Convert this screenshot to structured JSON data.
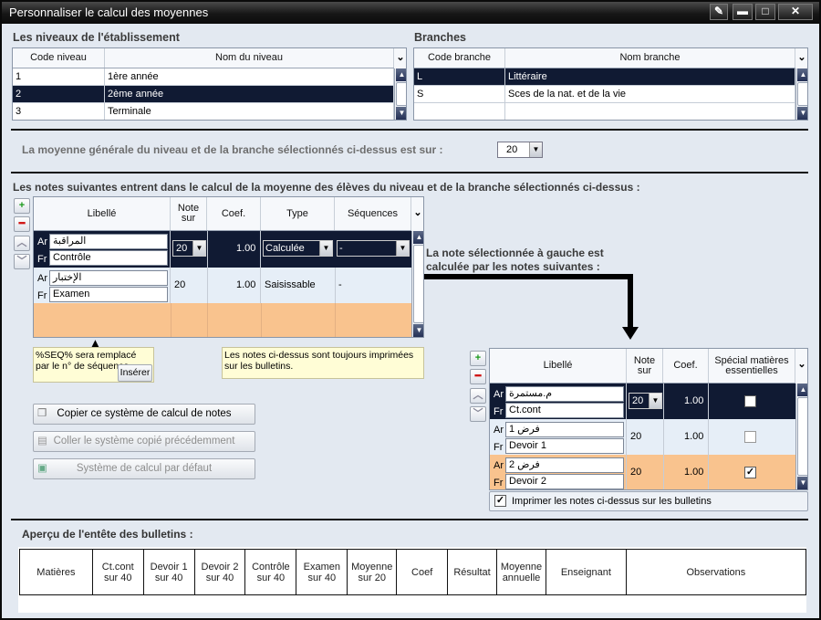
{
  "window": {
    "title": "Personnaliser le calcul des moyennes"
  },
  "niveaux": {
    "title": "Les niveaux de l'établissement",
    "col_code": "Code niveau",
    "col_nom": "Nom du niveau",
    "rows": [
      {
        "code": "1",
        "nom": "1ère année"
      },
      {
        "code": "2",
        "nom": "2ème année"
      },
      {
        "code": "3",
        "nom": "Terminale"
      }
    ],
    "selected_index": 1
  },
  "branches": {
    "title": "Branches",
    "col_code": "Code branche",
    "col_nom": "Nom branche",
    "rows": [
      {
        "code": "L",
        "nom": "Littéraire"
      },
      {
        "code": "S",
        "nom": "Sces de la nat. et de la vie"
      }
    ],
    "selected_index": 0
  },
  "moyenne": {
    "label": "La moyenne générale du niveau et de la branche sélectionnés ci-dessus est sur :",
    "value": "20"
  },
  "notes": {
    "title": "Les notes suivantes entrent dans le calcul de la moyenne des élèves du niveau et de la branche sélectionnés ci-dessus :",
    "col_libelle": "Libellé",
    "col_note": "Note sur",
    "col_coef": "Coef.",
    "col_type": "Type",
    "col_seq": "Séquences",
    "rows": [
      {
        "ar_tag": "Ar",
        "ar": "المراقبة",
        "fr_tag": "Fr",
        "fr": "Contrôle",
        "note": "20",
        "coef": "1.00",
        "type": "Calculée",
        "seq": "-"
      },
      {
        "ar_tag": "Ar",
        "ar": "الإختبار",
        "fr_tag": "Fr",
        "fr": "Examen",
        "note": "20",
        "coef": "1.00",
        "type": "Saisissable",
        "seq": "-"
      }
    ]
  },
  "tips": {
    "seq": "%SEQ% sera remplacé par le n° de séquence",
    "inserer": "Insérer",
    "print": "Les notes ci-dessus sont toujours imprimées sur les bulletins."
  },
  "actions": {
    "copy": "Copier ce système de calcul de notes",
    "paste": "Coller le système copié précédemment",
    "default": "Système de calcul par défaut"
  },
  "calc": {
    "label": "La note sélectionnée à gauche est calculée par les notes suivantes :",
    "col_libelle": "Libellé",
    "col_note": "Note sur",
    "col_coef": "Coef.",
    "col_special": "Spécial matières essentielles",
    "rows": [
      {
        "ar_tag": "Ar",
        "ar": "م.مستمرة",
        "fr_tag": "Fr",
        "fr": "Ct.cont",
        "note": "20",
        "coef": "1.00",
        "special": false
      },
      {
        "ar_tag": "Ar",
        "ar": "فرض 1",
        "fr_tag": "Fr",
        "fr": "Devoir 1",
        "note": "20",
        "coef": "1.00",
        "special": false
      },
      {
        "ar_tag": "Ar",
        "ar": "فرض 2",
        "fr_tag": "Fr",
        "fr": "Devoir 2",
        "note": "20",
        "coef": "1.00",
        "special": true
      }
    ],
    "print_label": "Imprimer les notes ci-dessus sur les bulletins",
    "print_checked": true
  },
  "apercu": {
    "title": "Aperçu de l'entête des bulletins",
    "columns": [
      "Matières",
      "Ct.cont sur 40",
      "Devoir 1 sur 40",
      "Devoir 2 sur 40",
      "Contrôle sur 40",
      "Examen sur 40",
      "Moyenne sur 20",
      "Coef",
      "Résultat",
      "Moyenne annuelle",
      "Enseignant",
      "Observations"
    ]
  },
  "colors": {
    "selection": "#101a33",
    "orange_row": "#f9c38e",
    "window_bg": "#e3e9f1",
    "tip_bg": "#fffdd6"
  }
}
